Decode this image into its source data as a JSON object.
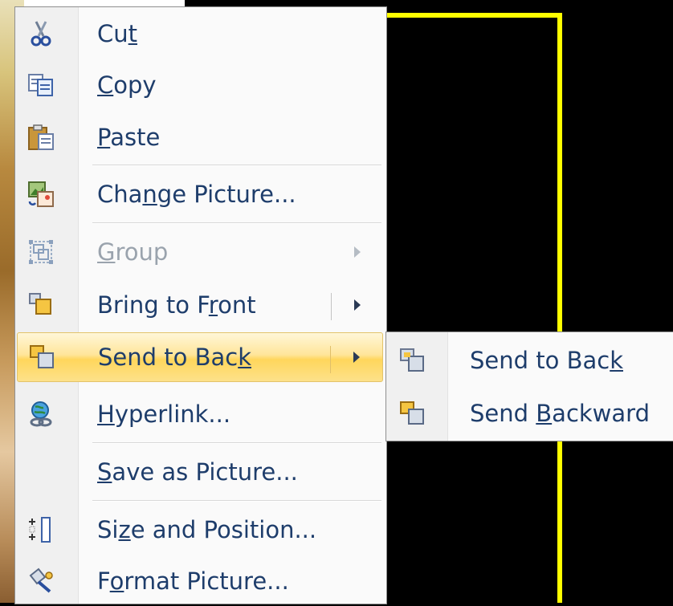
{
  "context_menu": {
    "items": [
      {
        "label_pre": "Cu",
        "mnemonic": "t",
        "label_post": "",
        "icon": "scissors-icon",
        "enabled": true
      },
      {
        "label_pre": "",
        "mnemonic": "C",
        "label_post": "opy",
        "icon": "copy-icon",
        "enabled": true
      },
      {
        "label_pre": "",
        "mnemonic": "P",
        "label_post": "aste",
        "icon": "paste-icon",
        "enabled": true
      },
      {
        "label_pre": "Cha",
        "mnemonic": "n",
        "label_post": "ge Picture...",
        "icon": "change-picture-icon",
        "enabled": true
      },
      {
        "label_pre": "",
        "mnemonic": "G",
        "label_post": "roup",
        "icon": "group-icon",
        "enabled": false
      },
      {
        "label_pre": "Bring to F",
        "mnemonic": "r",
        "label_post": "ont",
        "icon": "bring-to-front-icon",
        "enabled": true
      },
      {
        "label_pre": "Send to Bac",
        "mnemonic": "k",
        "label_post": "",
        "icon": "send-to-back-icon",
        "enabled": true
      },
      {
        "label_pre": "",
        "mnemonic": "H",
        "label_post": "yperlink...",
        "icon": "hyperlink-icon",
        "enabled": true
      },
      {
        "label_pre": "",
        "mnemonic": "S",
        "label_post": "ave as Picture...",
        "icon": "save-as-picture-icon",
        "enabled": true
      },
      {
        "label_pre": "Si",
        "mnemonic": "z",
        "label_post": "e and Position...",
        "icon": "size-position-icon",
        "enabled": true
      },
      {
        "label_pre": "F",
        "mnemonic": "o",
        "label_post": "rmat Picture...",
        "icon": "format-picture-icon",
        "enabled": true
      }
    ]
  },
  "submenu": {
    "items": [
      {
        "label_pre": "Send to Bac",
        "mnemonic": "k",
        "label_post": "",
        "icon": "send-to-back-icon"
      },
      {
        "label_pre": "Send ",
        "mnemonic": "B",
        "label_post": "ackward",
        "icon": "send-backward-icon"
      }
    ]
  },
  "colors": {
    "highlight": "#ffd65c",
    "label_text": "#1e3d6b",
    "disabled_text": "#9aa3ad",
    "frame": "#ffff00"
  }
}
